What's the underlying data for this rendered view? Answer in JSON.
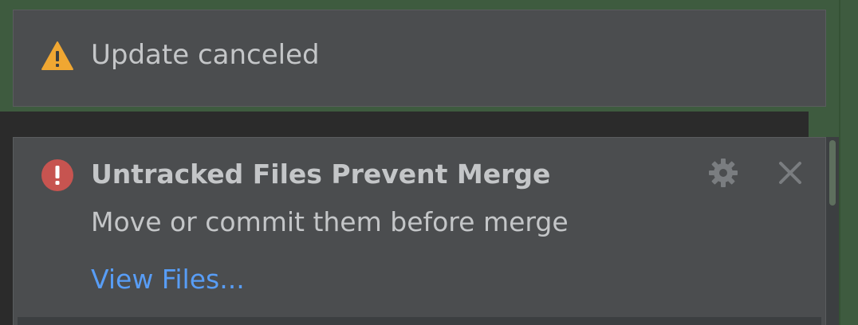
{
  "warning_balloon": {
    "text": "Update canceled",
    "icon": "warning-triangle-icon",
    "icon_color": "#f0a732"
  },
  "error_balloon": {
    "title": "Untracked Files Prevent Merge",
    "message": "Move or commit them before merge",
    "action_link": "View Files...",
    "icon": "error-circle-icon",
    "icon_color": "#c75450",
    "link_color": "#589df6"
  },
  "controls": {
    "settings_icon": "gear-icon",
    "close_icon": "close-icon"
  }
}
